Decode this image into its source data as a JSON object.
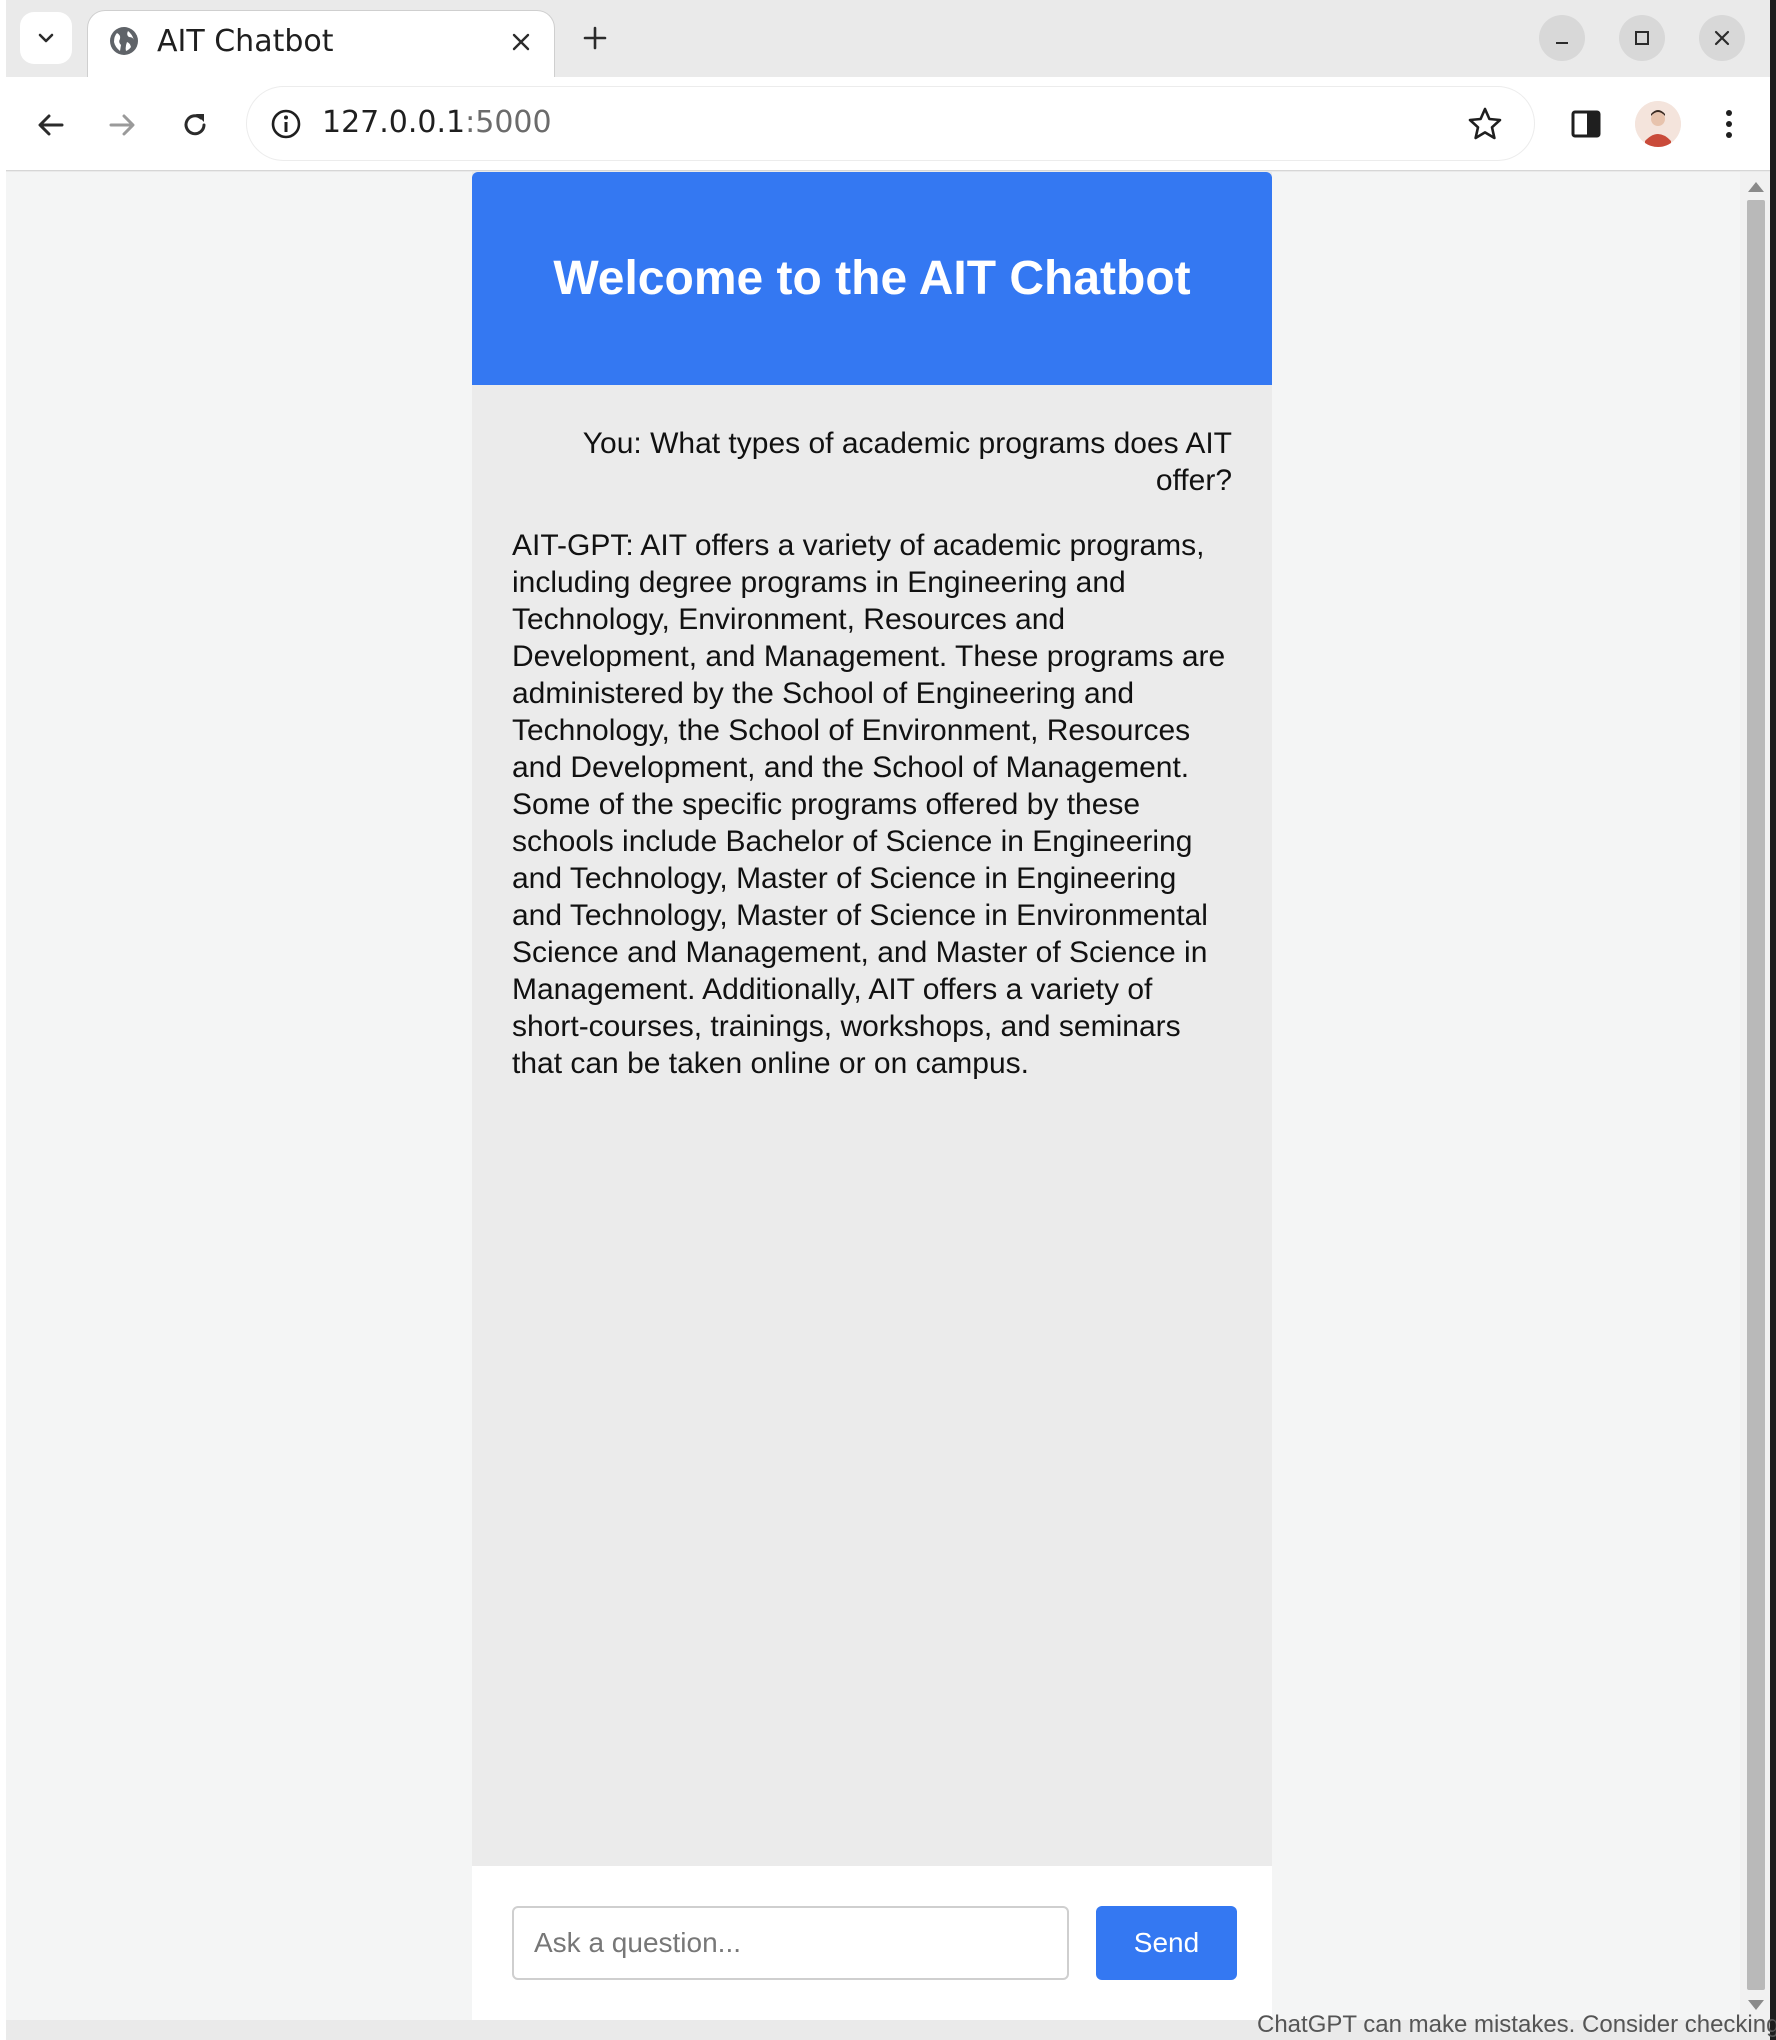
{
  "browser": {
    "tab": {
      "title": "AIT Chatbot"
    },
    "address_bar": {
      "host": "127.0.0.1",
      "port": ":5000"
    }
  },
  "chat": {
    "title": "Welcome to the AIT Chatbot",
    "messages": [
      {
        "sender": "user",
        "text": "You: What types of academic programs does AIT offer?"
      },
      {
        "sender": "bot",
        "text": "AIT-GPT: AIT offers a variety of academic programs, including degree programs in Engineering and Technology, Environment, Resources and Development, and Management. These programs are administered by the School of Engineering and Technology, the School of Environment, Resources and Development, and the School of Management. Some of the specific programs offered by these schools include Bachelor of Science in Engineering and Technology, Master of Science in Engineering and Technology, Master of Science in Environmental Science and Management, and Master of Science in Management. Additionally, AIT offers a variety of short-courses, trainings, workshops, and seminars that can be taken online or on campus."
      }
    ],
    "input": {
      "placeholder": "Ask a question...",
      "value": ""
    },
    "send_label": "Send"
  },
  "background_window": {
    "footer_text": "ChatGPT can make mistakes. Consider checking"
  },
  "colors": {
    "accent": "#3478f2",
    "chat_bg": "#ebebeb",
    "page_bg": "#f4f5f5"
  }
}
